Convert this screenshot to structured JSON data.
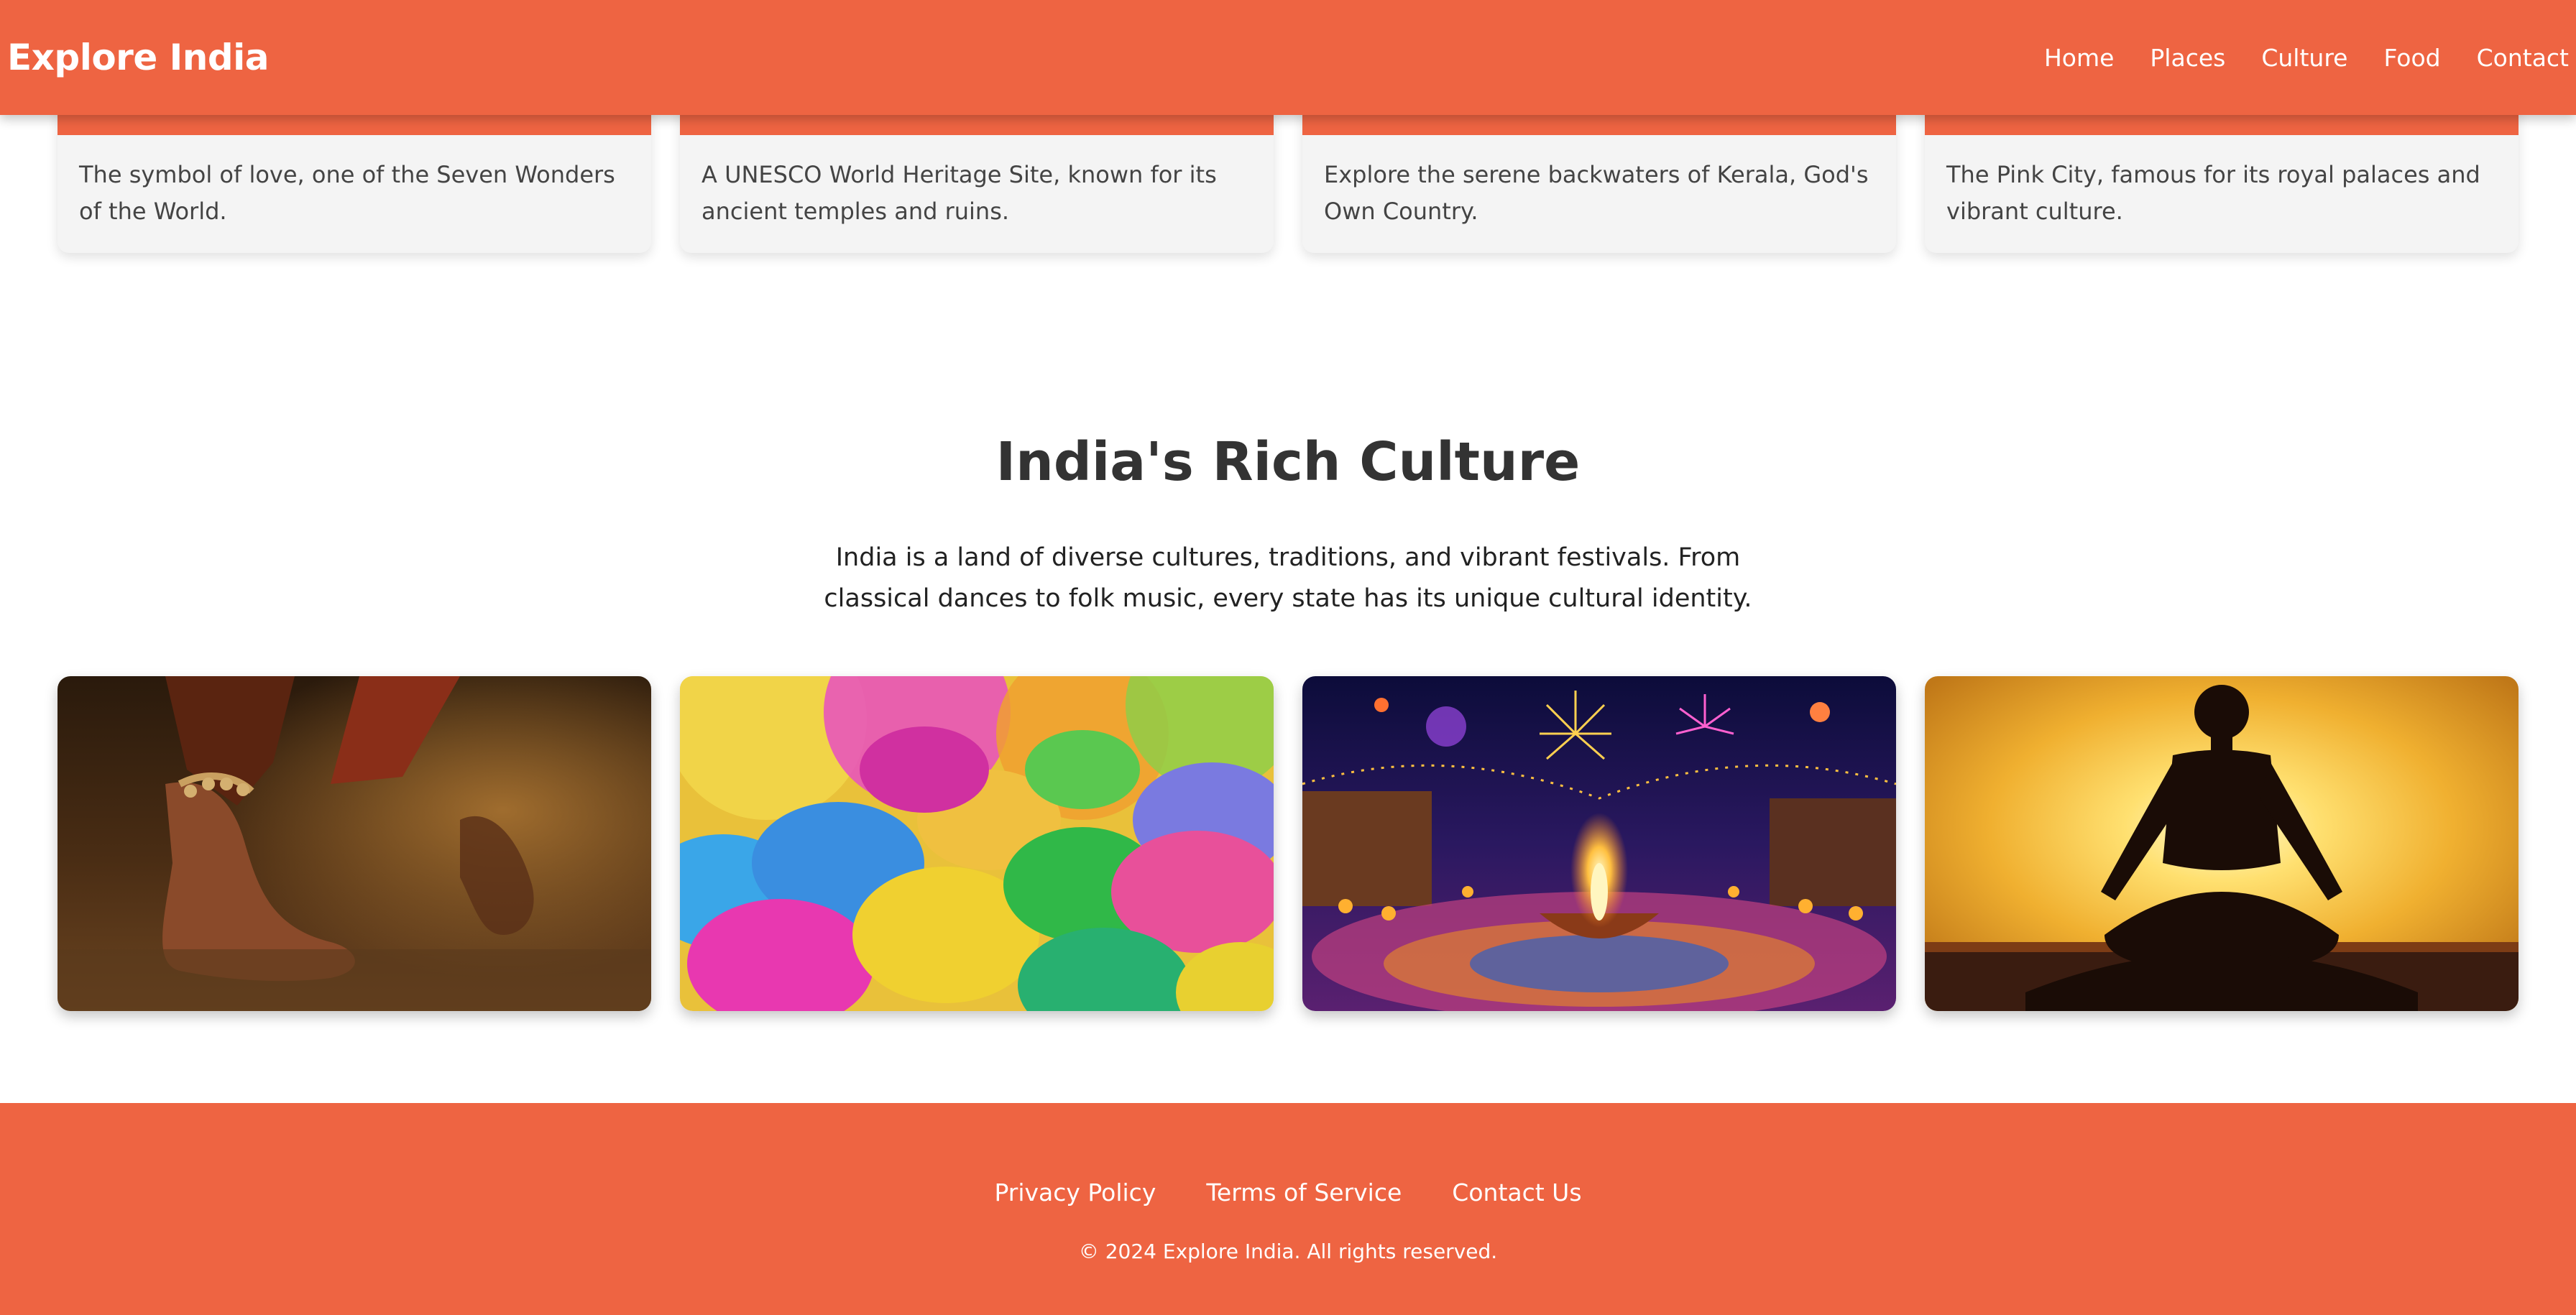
{
  "header": {
    "logo": "Explore India",
    "nav": [
      "Home",
      "Places",
      "Culture",
      "Food",
      "Contact"
    ]
  },
  "places": [
    {
      "description": "The symbol of love, one of the Seven Wonders of the World."
    },
    {
      "description": "A UNESCO World Heritage Site, known for its ancient temples and ruins."
    },
    {
      "description": "Explore the serene backwaters of Kerala, God's Own Country."
    },
    {
      "description": "The Pink City, famous for its royal palaces and vibrant culture."
    }
  ],
  "culture": {
    "title": "India's Rich Culture",
    "text": "India is a land of diverse cultures, traditions, and vibrant festivals. From classical dances to folk music, every state has its unique cultural identity.",
    "images": [
      "dance-photo",
      "holi-colors-photo",
      "diwali-festival-photo",
      "yoga-silhouette-photo"
    ]
  },
  "footer": {
    "links": [
      "Privacy Policy",
      "Terms of Service",
      "Contact Us"
    ],
    "copyright": "© 2024 Explore India. All rights reserved."
  },
  "colors": {
    "primary": "#ee6442",
    "card_bg": "#f4f4f4",
    "text_dark": "#333333"
  }
}
